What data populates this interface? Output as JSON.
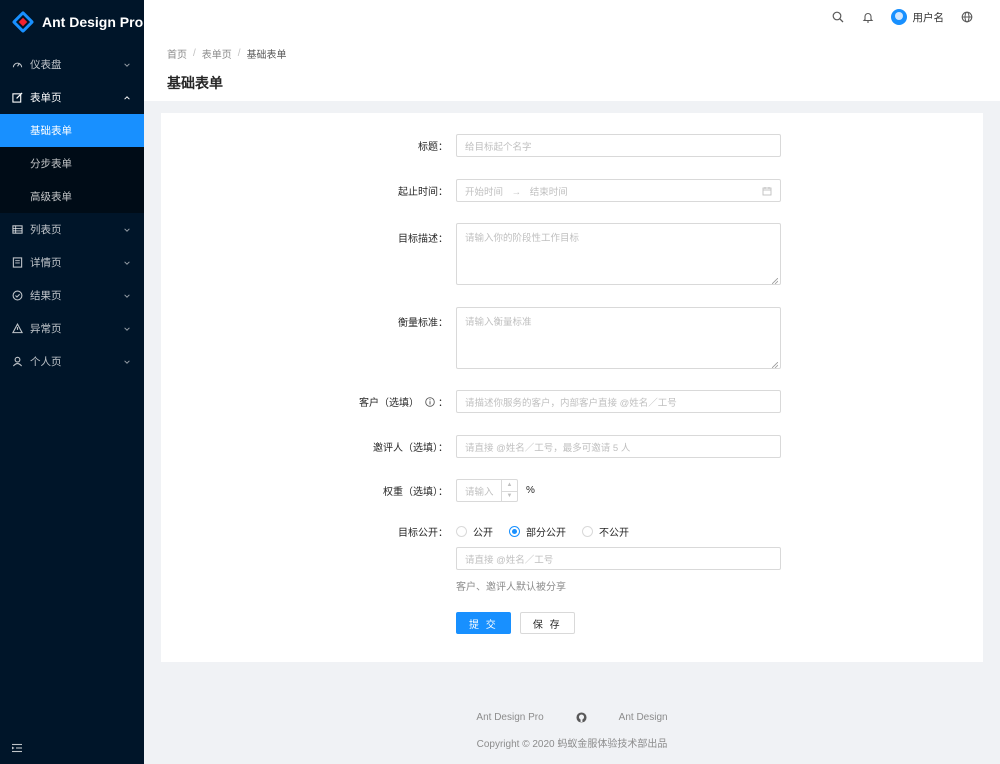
{
  "app": {
    "title": "Ant Design Pro"
  },
  "sidebar": {
    "items": [
      {
        "label": "仪表盘",
        "icon": "dashboard-icon"
      },
      {
        "label": "表单页",
        "icon": "form-icon",
        "open": true,
        "children": [
          {
            "label": "基础表单",
            "active": true
          },
          {
            "label": "分步表单"
          },
          {
            "label": "高级表单"
          }
        ]
      },
      {
        "label": "列表页",
        "icon": "table-icon"
      },
      {
        "label": "详情页",
        "icon": "profile-icon"
      },
      {
        "label": "结果页",
        "icon": "check-circle-icon"
      },
      {
        "label": "异常页",
        "icon": "warning-icon"
      },
      {
        "label": "个人页",
        "icon": "user-icon"
      }
    ]
  },
  "header": {
    "user_name": "用户名"
  },
  "breadcrumb": [
    "首页",
    "表单页",
    "基础表单"
  ],
  "page_title": "基础表单",
  "form": {
    "title_label": "标题：",
    "title_placeholder": "给目标起个名字",
    "date_label": "起止时间：",
    "date_start_placeholder": "开始时间",
    "date_arrow": "→",
    "date_end_placeholder": "结束时间",
    "goal_label": "目标描述：",
    "goal_placeholder": "请输入你的阶段性工作目标",
    "standard_label": "衡量标准：",
    "standard_placeholder": "请输入衡量标准",
    "client_label": "客户（选填）",
    "client_colon": "：",
    "client_placeholder": "请描述你服务的客户，内部客户直接 @姓名／工号",
    "invites_label": "邀评人（选填）：",
    "invites_placeholder": "请直接 @姓名／工号，最多可邀请 5 人",
    "weight_label": "权重（选填）：",
    "weight_placeholder": "请输入",
    "weight_unit": "%",
    "public_label": "目标公开：",
    "public_options": [
      "公开",
      "部分公开",
      "不公开"
    ],
    "public_selected": "部分公开",
    "public_target_placeholder": "请直接 @姓名／工号",
    "public_hint": "客户、邀评人默认被分享",
    "submit_label": "提 交",
    "save_label": "保 存"
  },
  "footer": {
    "links": [
      "Ant Design Pro",
      "Ant Design"
    ],
    "copyright": "Copyright © 2020 蚂蚁金服体验技术部出品"
  },
  "colors": {
    "primary": "#1890ff",
    "sider": "#001529"
  }
}
